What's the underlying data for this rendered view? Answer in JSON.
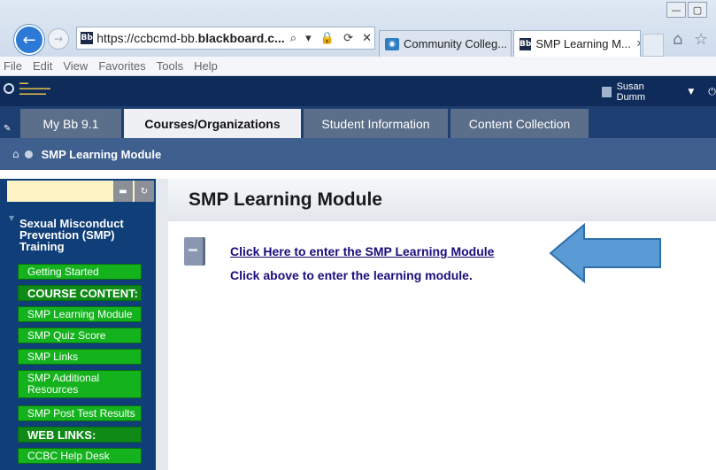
{
  "browser": {
    "window_controls": [
      "—",
      "▢"
    ],
    "address_prefix": "https://ccbcmd-bb.",
    "address_bold": "blackboard.c...",
    "address_tools": "⌕ ▾ 🔒 ⟳ ✕",
    "tabs": [
      {
        "label": "Community Colleg...",
        "icon": "globe-icon"
      },
      {
        "label": "SMP Learning M...",
        "icon": "blackboard-icon",
        "close": "✕"
      }
    ],
    "bb_favicon_text": "Bb"
  },
  "menubar": [
    "File",
    "Edit",
    "View",
    "Favorites",
    "Tools",
    "Help"
  ],
  "header": {
    "user_name": "Susan Dumm"
  },
  "bb_tabs": [
    "My Bb 9.1",
    "Courses/Organizations",
    "Student Information",
    "Content Collection"
  ],
  "breadcrumb": {
    "current": "SMP Learning Module"
  },
  "sidebar": {
    "course_title": "Sexual Misconduct Prevention (SMP) Training",
    "items": [
      {
        "label": "Getting Started",
        "type": "link"
      },
      {
        "label": "COURSE CONTENT:",
        "type": "heading"
      },
      {
        "label": "SMP Learning Module",
        "type": "link"
      },
      {
        "label": "SMP Quiz Score",
        "type": "link"
      },
      {
        "label": "SMP Links",
        "type": "link"
      },
      {
        "label": "SMP Additional Resources",
        "type": "link"
      },
      {
        "label": "SMP Post Test Results",
        "type": "link"
      },
      {
        "label": "WEB LINKS:",
        "type": "heading"
      },
      {
        "label": "CCBC Help Desk",
        "type": "link"
      }
    ]
  },
  "content": {
    "title": "SMP Learning Module",
    "item_link": "Click Here to enter the SMP Learning Module",
    "item_description": "Click above to enter the learning module."
  },
  "colors": {
    "header_navy": "#0f2b5a",
    "sidebar_blue": "#0f3e78",
    "menu_green": "#14b31e",
    "link_purple": "#1a0d7c",
    "arrow_blue": "#5b9bd5"
  }
}
